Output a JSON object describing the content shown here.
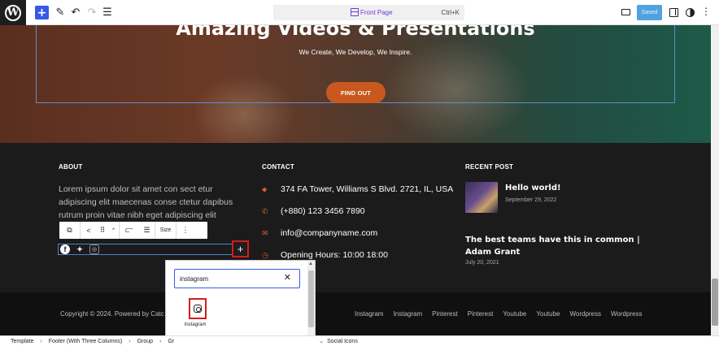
{
  "topbar": {
    "logo": "W",
    "command_title": "Front Page",
    "command_shortcut": "Ctrl+K",
    "saved_label": "Saved",
    "icons": [
      "wordpress-icon",
      "plus-icon",
      "pen-icon",
      "undo-icon",
      "redo-icon",
      "list-view-icon",
      "desktop-icon",
      "settings-panel-icon",
      "styles-icon",
      "more-icon"
    ]
  },
  "hero": {
    "title": "Amazing Videos & Presentations",
    "subtitle": "We Create, We Develop, We Inspire.",
    "button": "FIND OUT"
  },
  "about": {
    "heading": "ABOUT",
    "text": "Lorem ipsum dolor sit amet con sect etur adipiscing elit maecenas conse ctetur dapibus rutrum proin vitae nibh eget adipiscing elit"
  },
  "block_toolbar": {
    "size_label": "Size"
  },
  "contact": {
    "heading": "CONTACT",
    "address": "374 FA Tower, Williams S Blvd. 2721, IL, USA",
    "phone": "(+880) 123 3456 7890",
    "email": "info@companyname.com",
    "hours": "Opening Hours: 10:00 18:00"
  },
  "recent": {
    "heading": "RECENT POST",
    "post1_title": "Hello world!",
    "post1_date": "September 29, 2022",
    "post2_title": "The best teams have this in common | Adam Grant",
    "post2_date": "July 20, 2021"
  },
  "footer_bar": {
    "copyright": "Copyright © 2024. Powered by Catc",
    "links": [
      "Instagram",
      "Instagram",
      "Pinterest",
      "Pinterest",
      "Youtube",
      "Youtube",
      "Wordpress",
      "Wordpress"
    ]
  },
  "inserter": {
    "search_value": "instagram",
    "result_label": "Instagram"
  },
  "breadcrumb": {
    "items": [
      "Template",
      "Footer (With Three Columns)",
      "Group",
      "Gr"
    ],
    "last": "Social Icons"
  },
  "colors": {
    "accent": "#3858e9",
    "orange": "#c9581e",
    "highlight": "#d61c1c"
  }
}
